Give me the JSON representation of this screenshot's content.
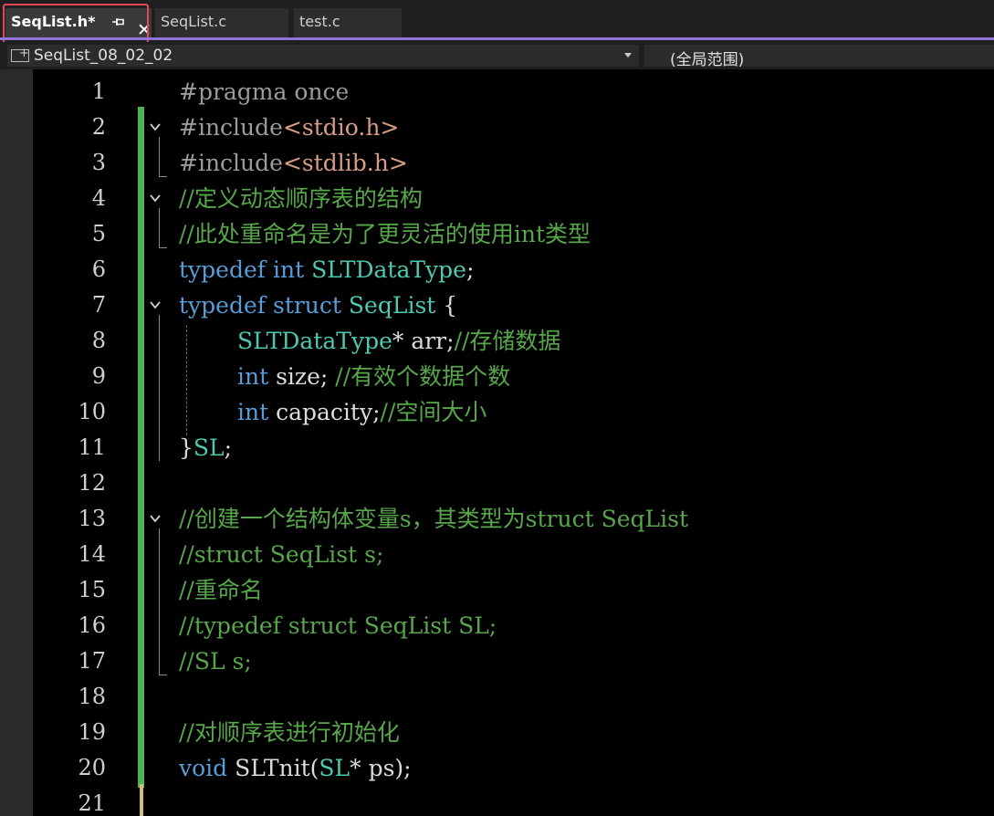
{
  "tabs": [
    {
      "label": "SeqList.h*",
      "active": true
    },
    {
      "label": "SeqList.c",
      "active": false
    },
    {
      "label": "test.c",
      "active": false
    }
  ],
  "nav": {
    "project": "SeqList_08_02_02",
    "scope": "(全局范围)"
  },
  "editor": {
    "line_numbers": [
      "1",
      "2",
      "3",
      "4",
      "5",
      "6",
      "7",
      "8",
      "9",
      "10",
      "11",
      "12",
      "13",
      "14",
      "15",
      "16",
      "17",
      "18",
      "19",
      "20",
      "21"
    ],
    "lines": [
      [
        {
          "t": "#pragma once",
          "c": "pp"
        }
      ],
      [
        {
          "t": "#include",
          "c": "pp"
        },
        {
          "t": "<stdio.h>",
          "c": "st"
        }
      ],
      [
        {
          "t": "#include",
          "c": "pp"
        },
        {
          "t": "<stdlib.h>",
          "c": "st"
        }
      ],
      [
        {
          "t": "//定义动态顺序表的结构",
          "c": "cm"
        }
      ],
      [
        {
          "t": "//此处重命名是为了更灵活的使用int类型",
          "c": "cm"
        }
      ],
      [
        {
          "t": "typedef",
          "c": "kw"
        },
        {
          "t": " ",
          "c": "pl"
        },
        {
          "t": "int",
          "c": "kw"
        },
        {
          "t": " ",
          "c": "pl"
        },
        {
          "t": "SLTDataType",
          "c": "ty"
        },
        {
          "t": ";",
          "c": "pl"
        }
      ],
      [
        {
          "t": "typedef",
          "c": "kw"
        },
        {
          "t": " ",
          "c": "pl"
        },
        {
          "t": "struct",
          "c": "kw"
        },
        {
          "t": " ",
          "c": "pl"
        },
        {
          "t": "SeqList",
          "c": "ty"
        },
        {
          "t": " {",
          "c": "pl"
        }
      ],
      [
        {
          "t": "SLTDataType",
          "c": "ty"
        },
        {
          "t": "* arr;",
          "c": "pl"
        },
        {
          "t": "//存储数据",
          "c": "cm"
        }
      ],
      [
        {
          "t": "int",
          "c": "kw"
        },
        {
          "t": " size; ",
          "c": "pl"
        },
        {
          "t": "//有效个数据个数",
          "c": "cm"
        }
      ],
      [
        {
          "t": "int",
          "c": "kw"
        },
        {
          "t": " capacity;",
          "c": "pl"
        },
        {
          "t": "//空间大小",
          "c": "cm"
        }
      ],
      [
        {
          "t": "}",
          "c": "pl"
        },
        {
          "t": "SL",
          "c": "ty"
        },
        {
          "t": ";",
          "c": "pl"
        }
      ],
      [],
      [
        {
          "t": "//创建一个结构体变量s，其类型为struct SeqList",
          "c": "cm"
        }
      ],
      [
        {
          "t": "//struct SeqList s;",
          "c": "cm"
        }
      ],
      [
        {
          "t": "//重命名",
          "c": "cm"
        }
      ],
      [
        {
          "t": "//typedef struct SeqList SL;",
          "c": "cm"
        }
      ],
      [
        {
          "t": "//SL s;",
          "c": "cm"
        }
      ],
      [],
      [
        {
          "t": "//对顺序表进行初始化",
          "c": "cm"
        }
      ],
      [
        {
          "t": "void",
          "c": "kw"
        },
        {
          "t": " SLTnit(",
          "c": "pl"
        },
        {
          "t": "SL",
          "c": "ty"
        },
        {
          "t": "* ps);",
          "c": "pl"
        }
      ],
      []
    ],
    "indented_lines": [
      8,
      9,
      10
    ],
    "fold_lines": [
      2,
      4,
      7,
      13
    ]
  },
  "colors": {
    "keyword": "#569cd6",
    "type": "#4ec9b0",
    "comment": "#57a64a",
    "string": "#d69d85",
    "preprocessor": "#9b9b9b",
    "changed_marker": "#4fb356",
    "tab_highlight": "#e8445a",
    "tab_accent": "#8f74d9"
  }
}
